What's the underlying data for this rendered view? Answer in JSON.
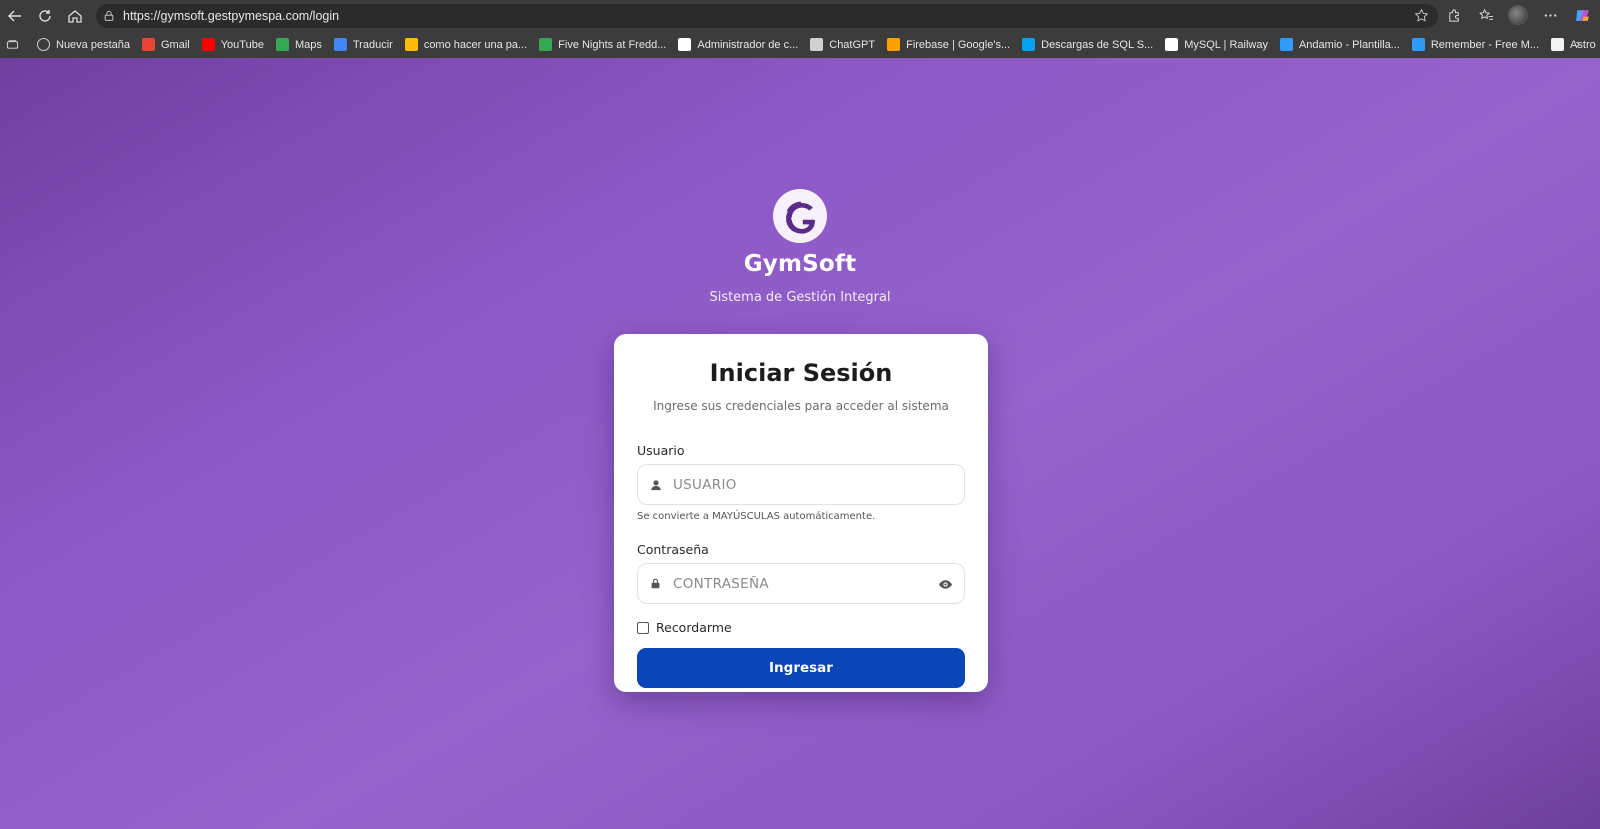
{
  "browser": {
    "url": "https://gymsoft.gestpymespa.com/login",
    "bookmarks": [
      {
        "label": "Nueva pestaña",
        "color": "#cfcfcf"
      },
      {
        "label": "Gmail",
        "color": "#ea4335"
      },
      {
        "label": "YouTube",
        "color": "#ff0000"
      },
      {
        "label": "Maps",
        "color": "#34a853"
      },
      {
        "label": "Traducir",
        "color": "#4285f4"
      },
      {
        "label": "como hacer una pa...",
        "color": "#fbbc04"
      },
      {
        "label": "Five Nights at Fredd...",
        "color": "#34a853"
      },
      {
        "label": "Administrador de c...",
        "color": "#ffffff"
      },
      {
        "label": "ChatGPT",
        "color": "#d0d0d0"
      },
      {
        "label": "Firebase | Google's...",
        "color": "#ffa000"
      },
      {
        "label": "Descargas de SQL S...",
        "color": "#00a4ef"
      },
      {
        "label": "MySQL | Railway",
        "color": "#ffffff"
      },
      {
        "label": "Andamio - Plantilla...",
        "color": "#2f9bff"
      },
      {
        "label": "Remember - Free M...",
        "color": "#2f9bff"
      },
      {
        "label": "Astro",
        "color": "#f3f3f3"
      }
    ]
  },
  "brand": {
    "name": "GymSoft",
    "subtitle": "Sistema de Gestión Integral",
    "accent": "#5a2a8c"
  },
  "login": {
    "title": "Iniciar Sesión",
    "subtitle": "Ingrese sus credenciales para acceder al sistema",
    "username_label": "Usuario",
    "username_placeholder": "USUARIO",
    "username_hint": "Se convierte a MAYÚSCULAS automáticamente.",
    "password_label": "Contraseña",
    "password_placeholder": "CONTRASEÑA",
    "remember_label": "Recordarme",
    "submit_label": "Ingresar",
    "button_color": "#0a46b8"
  }
}
